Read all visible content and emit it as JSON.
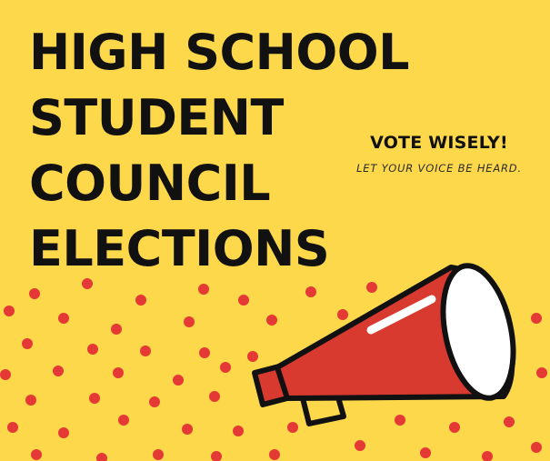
{
  "colors": {
    "background": "#fcd84a",
    "dots": "#e53935",
    "megaphone": "#d93a2f",
    "outline": "#111111",
    "text": "#111111"
  },
  "headline": {
    "lines": [
      "HIGH SCHOOL",
      "STUDENT",
      "COUNCIL",
      "ELECTIONS"
    ]
  },
  "tagline": {
    "title": "VOTE WISELY!",
    "subtitle": "LET YOUR VOICE BE HEARD."
  },
  "illustration": {
    "icon": "megaphone-icon",
    "pattern": "polka-dots"
  }
}
